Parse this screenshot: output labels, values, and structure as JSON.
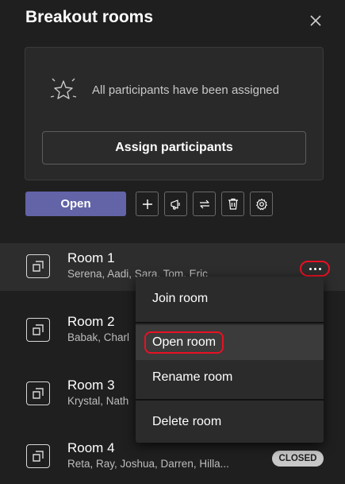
{
  "header": {
    "title": "Breakout rooms"
  },
  "assigned_card": {
    "message": "All participants have been assigned",
    "assign_button_label": "Assign participants"
  },
  "toolbar": {
    "open_label": "Open",
    "tools": [
      "add-icon",
      "announcement-icon",
      "recreate-rooms-icon",
      "delete-icon",
      "settings-icon"
    ]
  },
  "rooms": [
    {
      "name": "Room 1",
      "members": "Serena, Aadi, Sara, Tom, Eric"
    },
    {
      "name": "Room 2",
      "members": "Babak, Charl"
    },
    {
      "name": "Room 3",
      "members": "Krystal, Nath"
    },
    {
      "name": "Room 4",
      "members": "Reta, Ray, Joshua, Darren, Hilla...",
      "status": "CLOSED"
    }
  ],
  "context_menu": {
    "items": [
      "Join room",
      "Open room",
      "Rename room",
      "Delete room"
    ],
    "highlighted": "Open room"
  },
  "colors": {
    "background": "#1f1f1f",
    "accent": "#6264a7",
    "highlight_ring": "#e81123",
    "badge": "#c8c8c8"
  }
}
